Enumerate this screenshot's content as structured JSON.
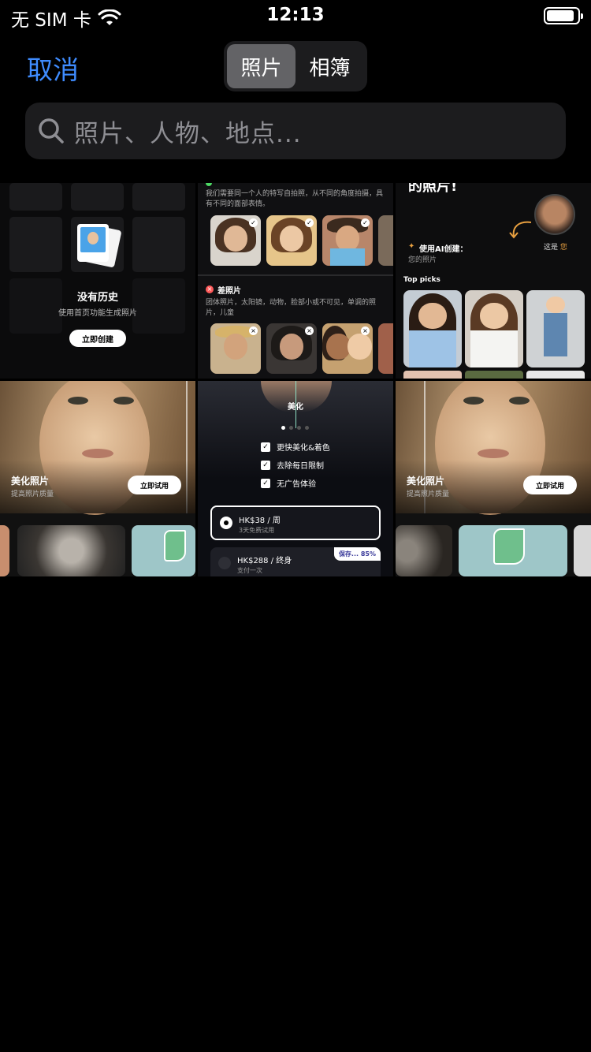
{
  "status_bar": {
    "carrier": "无 SIM 卡",
    "time": "12:13",
    "battery_level": 0.9
  },
  "nav": {
    "cancel_label": "取消",
    "tabs": [
      {
        "label": "照片",
        "active": true
      },
      {
        "label": "相簿",
        "active": false
      }
    ]
  },
  "search": {
    "placeholder": "照片、人物、地点..."
  },
  "thumbnails": {
    "history": {
      "title": "没有历史",
      "subtitle": "使用首页功能生成照片",
      "button": "立即创建"
    },
    "guide": {
      "good_desc": "我们需要同一个人的特写自拍照，从不同的角度拍摄，具有不同的面部表情。",
      "bad_title": "差照片",
      "bad_desc": "团体照片，太阳镜，动物，脸部小或不可见，单调的照片，儿童"
    },
    "ai": {
      "fragment": "的照片!",
      "you_label": "这是",
      "you_highlight": "您",
      "create_title": "使用AI创建：",
      "create_sub": "您的照片",
      "top_picks": "Top picks"
    },
    "enhance": {
      "title": "美化照片",
      "subtitle": "提高照片质量",
      "button": "立即试用"
    },
    "paywall": {
      "title": "美化",
      "features": [
        "更快美化&着色",
        "去除每日限制",
        "无广告体验"
      ],
      "plan1_price": "HK$38 / 周",
      "plan1_sub": "3天免费试用",
      "plan2_price": "HK$288 / 终身",
      "plan2_sub": "支付一次",
      "save_badge": "保存... 85%"
    },
    "enhance2": {
      "title": "美化照片",
      "subtitle": "提高照片质量",
      "button": "立即试用"
    }
  },
  "colors": {
    "accent": "#3f8cff",
    "background": "#000000",
    "search_bg": "#1c1c1e",
    "segment_active": "#636366",
    "highlight": "#e8a040"
  }
}
